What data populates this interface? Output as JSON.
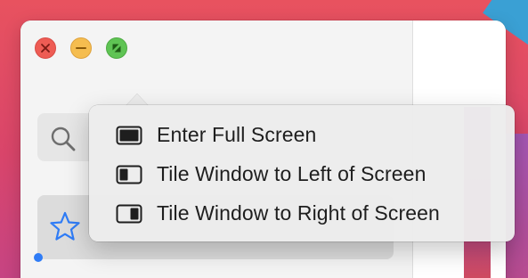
{
  "window_controls": {
    "close_icon": "close-icon",
    "minimize_icon": "minimize-icon",
    "zoom_icon": "fullscreen-icon",
    "colors": {
      "close": "#ee5c54",
      "minimize": "#f5bd4f",
      "zoom": "#5fc454"
    }
  },
  "sidebar": {
    "search_icon": "search-icon",
    "selected_item_icon": "star-icon",
    "accent": "#2f7cf6"
  },
  "window_menu": {
    "items": [
      {
        "label": "Enter Full Screen",
        "icon": "full-screen-icon"
      },
      {
        "label": "Tile Window to Left of Screen",
        "icon": "tile-left-icon"
      },
      {
        "label": "Tile Window to Right of Screen",
        "icon": "tile-right-icon"
      }
    ]
  }
}
